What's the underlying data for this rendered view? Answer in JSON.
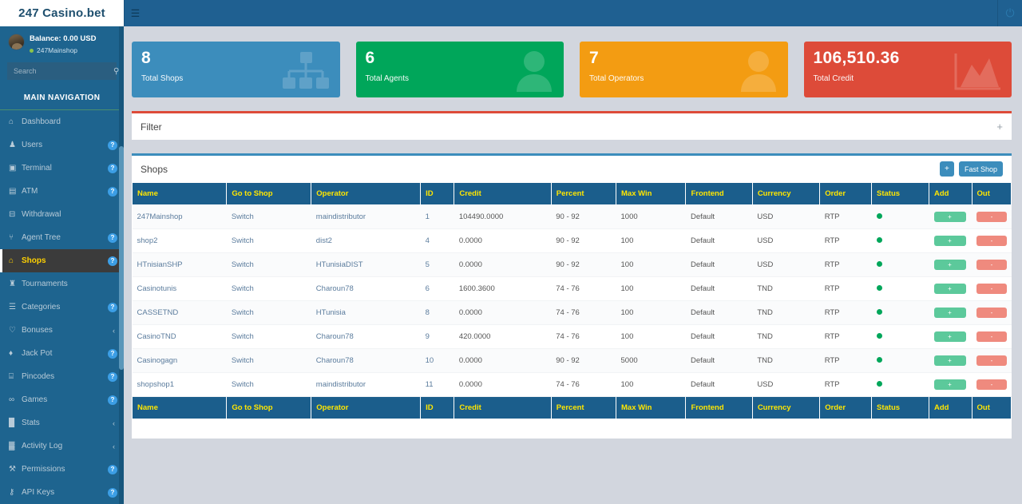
{
  "brand": {
    "title": "247 Casino.bet"
  },
  "topbar": {
    "menu_icon": "hamburger-icon",
    "power_icon": "power-icon"
  },
  "sidebar": {
    "balance": "Balance: 0.00 USD",
    "username": "247Mainshop",
    "search": {
      "placeholder": "Search",
      "value": "",
      "icon": "search-icon"
    },
    "nav_title": "MAIN NAVIGATION",
    "items": [
      {
        "label": "Dashboard",
        "icon": "home-icon",
        "badge": "",
        "active": false
      },
      {
        "label": "Users",
        "icon": "user-icon",
        "badge": "?",
        "active": false
      },
      {
        "label": "Terminal",
        "icon": "terminal-icon",
        "badge": "?",
        "active": false
      },
      {
        "label": "ATM",
        "icon": "credit-card-icon",
        "badge": "?",
        "active": false
      },
      {
        "label": "Withdrawal",
        "icon": "money-icon",
        "badge": "",
        "active": false
      },
      {
        "label": "Agent Tree",
        "icon": "sitemap-icon",
        "badge": "?",
        "active": false
      },
      {
        "label": "Shops",
        "icon": "bank-icon",
        "badge": "?",
        "active": true
      },
      {
        "label": "Tournaments",
        "icon": "trophy-icon",
        "badge": "",
        "active": false
      },
      {
        "label": "Categories",
        "icon": "list-icon",
        "badge": "?",
        "active": false
      },
      {
        "label": "Bonuses",
        "icon": "gift-icon",
        "badge": "<",
        "active": false
      },
      {
        "label": "Jack Pot",
        "icon": "diamond-icon",
        "badge": "?",
        "active": false
      },
      {
        "label": "Pincodes",
        "icon": "keypad-icon",
        "badge": "?",
        "active": false
      },
      {
        "label": "Games",
        "icon": "gamepad-icon",
        "badge": "?",
        "active": false
      },
      {
        "label": "Stats",
        "icon": "stats-icon",
        "badge": "<",
        "active": false
      },
      {
        "label": "Activity Log",
        "icon": "chart-icon",
        "badge": "<",
        "active": false
      },
      {
        "label": "Permissions",
        "icon": "key-icon",
        "badge": "?",
        "active": false
      },
      {
        "label": "API Keys",
        "icon": "api-key-icon",
        "badge": "?",
        "active": false
      }
    ]
  },
  "cards": [
    {
      "value": "8",
      "caption": "Total Shops",
      "color": "#3c8dbc",
      "icon": "sitemap-icon"
    },
    {
      "value": "6",
      "caption": "Total Agents",
      "color": "#00a65a",
      "icon": "user-icon"
    },
    {
      "value": "7",
      "caption": "Total Operators",
      "color": "#f39c12",
      "icon": "user-icon"
    },
    {
      "value": "106,510.36",
      "caption": "Total Credit",
      "color": "#dd4b39",
      "icon": "area-chart-icon"
    }
  ],
  "filter_box": {
    "title": "Filter",
    "expand_icon": "plus-icon",
    "border_color": "#dd4b39"
  },
  "shops_box": {
    "title": "Shops",
    "add_label": "+",
    "fast_shop_label": "Fast Shop",
    "border_color": "#3c8dbc"
  },
  "table": {
    "columns": [
      "Name",
      "Go to Shop",
      "Operator",
      "ID",
      "Credit",
      "Percent",
      "Max Win",
      "Frontend",
      "Currency",
      "Order",
      "Status",
      "Add",
      "Out"
    ],
    "rows": [
      {
        "name": "247Mainshop",
        "go_to_shop": "Switch",
        "operator": "maindistributor",
        "id": "1",
        "credit": "104490.0000",
        "percent": "90 - 92",
        "max_win": "1000",
        "frontend": "Default",
        "currency": "USD",
        "order": "RTP",
        "status": "active",
        "add": "+",
        "out": "-"
      },
      {
        "name": "shop2",
        "go_to_shop": "Switch",
        "operator": "dist2",
        "id": "4",
        "credit": "0.0000",
        "percent": "90 - 92",
        "max_win": "100",
        "frontend": "Default",
        "currency": "USD",
        "order": "RTP",
        "status": "active",
        "add": "+",
        "out": "-"
      },
      {
        "name": "HTnisianSHP",
        "go_to_shop": "Switch",
        "operator": "HTunisiaDIST",
        "id": "5",
        "credit": "0.0000",
        "percent": "90 - 92",
        "max_win": "100",
        "frontend": "Default",
        "currency": "USD",
        "order": "RTP",
        "status": "active",
        "add": "+",
        "out": "-"
      },
      {
        "name": "Casinotunis",
        "go_to_shop": "Switch",
        "operator": "Charoun78",
        "id": "6",
        "credit": "1600.3600",
        "percent": "74 - 76",
        "max_win": "100",
        "frontend": "Default",
        "currency": "TND",
        "order": "RTP",
        "status": "active",
        "add": "+",
        "out": "-"
      },
      {
        "name": "CASSETND",
        "go_to_shop": "Switch",
        "operator": "HTunisia",
        "id": "8",
        "credit": "0.0000",
        "percent": "74 - 76",
        "max_win": "100",
        "frontend": "Default",
        "currency": "TND",
        "order": "RTP",
        "status": "active",
        "add": "+",
        "out": "-"
      },
      {
        "name": "CasinoTND",
        "go_to_shop": "Switch",
        "operator": "Charoun78",
        "id": "9",
        "credit": "420.0000",
        "percent": "74 - 76",
        "max_win": "100",
        "frontend": "Default",
        "currency": "TND",
        "order": "RTP",
        "status": "active",
        "add": "+",
        "out": "-"
      },
      {
        "name": "Casinogagn",
        "go_to_shop": "Switch",
        "operator": "Charoun78",
        "id": "10",
        "credit": "0.0000",
        "percent": "90 - 92",
        "max_win": "5000",
        "frontend": "Default",
        "currency": "TND",
        "order": "RTP",
        "status": "active",
        "add": "+",
        "out": "-"
      },
      {
        "name": "shopshop1",
        "go_to_shop": "Switch",
        "operator": "maindistributor",
        "id": "11",
        "credit": "0.0000",
        "percent": "74 - 76",
        "max_win": "100",
        "frontend": "Default",
        "currency": "USD",
        "order": "RTP",
        "status": "active",
        "add": "+",
        "out": "-"
      }
    ]
  },
  "colors": {
    "header_bg": "#1f6091",
    "sidebar_bg": "#1e648f",
    "table_header_bg": "#1b5e8c",
    "table_header_text": "#ffe600",
    "accent": "#3c8dbc",
    "status_green": "#00a65a",
    "add_green": "#5cc99b",
    "out_red": "#ef8a7e"
  }
}
